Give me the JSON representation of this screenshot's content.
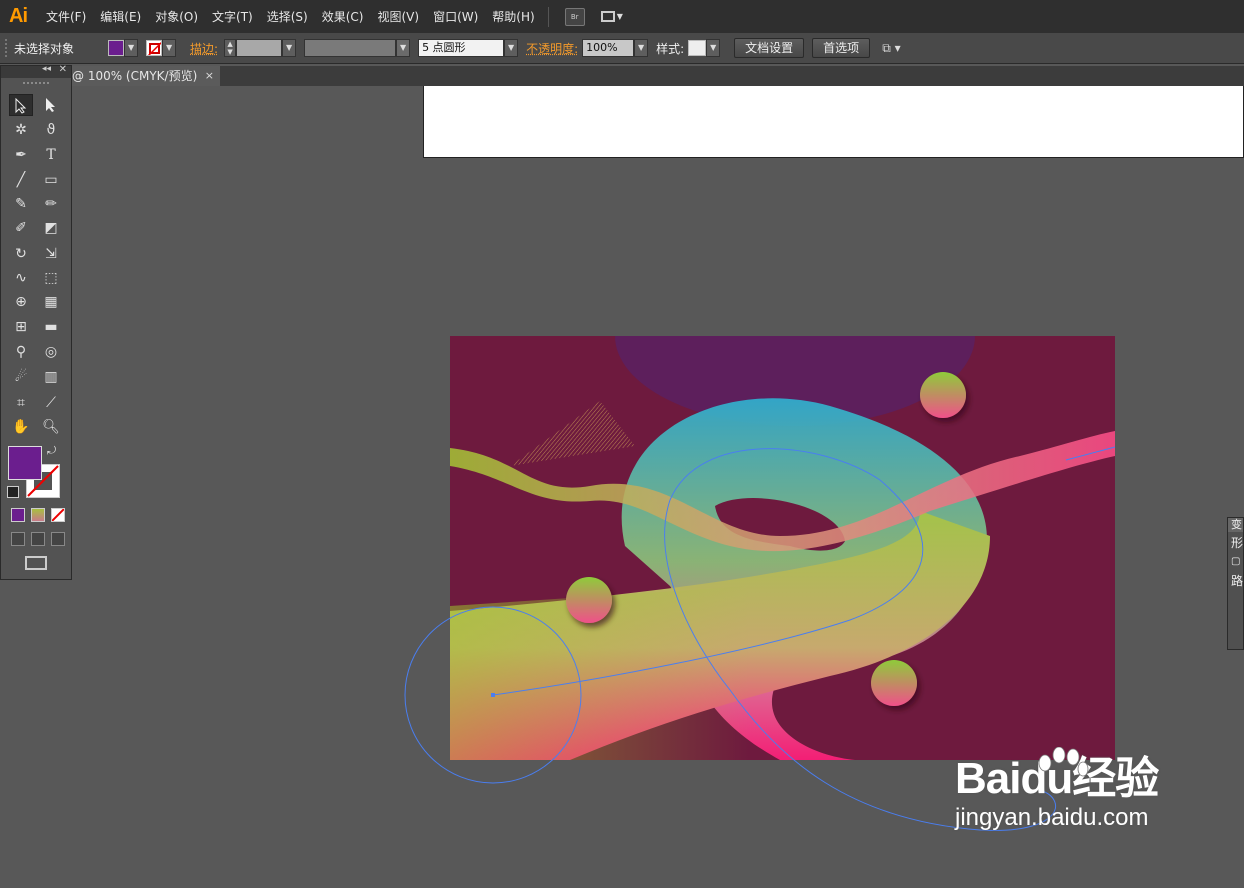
{
  "app": {
    "logo": "Ai"
  },
  "menu": {
    "items": [
      "文件(F)",
      "编辑(E)",
      "对象(O)",
      "文字(T)",
      "选择(S)",
      "效果(C)",
      "视图(V)",
      "窗口(W)",
      "帮助(H)"
    ],
    "bridge_label": "Br"
  },
  "control_bar": {
    "selection_status": "未选择对象",
    "stroke_label": "描边:",
    "brush_value": "5 点圆形",
    "opacity_label": "不透明度:",
    "opacity_value": "100%",
    "style_label": "样式:",
    "doc_setup_button": "文档设置",
    "preferences_button": "首选项"
  },
  "document_tab": {
    "title": "@ 100% (CMYK/预览)",
    "close": "×"
  },
  "colors": {
    "fill": "#6b1e8e",
    "artboard_bg": "#6e1a3e",
    "accent_orange": "#f39a2b"
  },
  "right_panel": {
    "tab": "变",
    "items": [
      "形",
      "路"
    ]
  },
  "watermark": {
    "brand": "Baidu经验",
    "url": "jingyan.baidu.com"
  }
}
